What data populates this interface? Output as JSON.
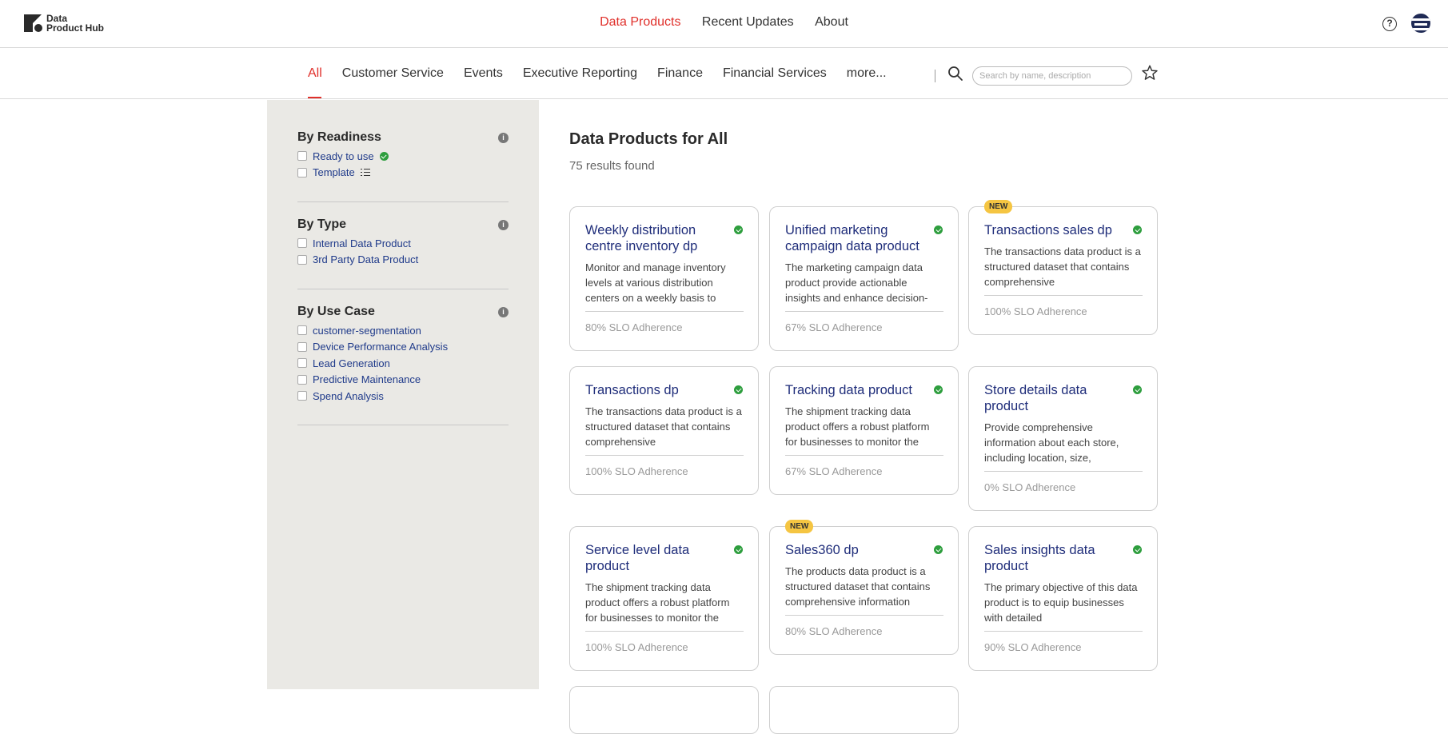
{
  "header": {
    "logo_line1": "Data",
    "logo_line2": "Product Hub",
    "nav": [
      "Data Products",
      "Recent Updates",
      "About"
    ],
    "help_glyph": "?"
  },
  "categories": {
    "tabs": [
      "All",
      "Customer Service",
      "Events",
      "Executive Reporting",
      "Finance",
      "Financial Services",
      "more..."
    ],
    "search_placeholder": "Search by name, description"
  },
  "sidebar": {
    "groups": [
      {
        "title": "By Readiness",
        "items": [
          "Ready to use",
          "Template"
        ]
      },
      {
        "title": "By Type",
        "items": [
          "Internal Data Product",
          "3rd Party Data Product"
        ]
      },
      {
        "title": "By Use Case",
        "items": [
          "customer-segmentation",
          "Device Performance Analysis",
          "Lead Generation",
          "Predictive Maintenance",
          "Spend Analysis"
        ]
      }
    ]
  },
  "main": {
    "title": "Data Products for All",
    "results": "75 results found",
    "new_label": "NEW",
    "cards": [
      {
        "title": "Weekly distribution centre inventory dp",
        "desc": "Monitor and manage inventory levels at various distribution centers on a weekly basis to",
        "slo": "80% SLO Adherence"
      },
      {
        "title": "Unified marketing campaign data product",
        "desc": "The marketing campaign data product provide actionable insights and enhance decision-",
        "slo": "67% SLO Adherence"
      },
      {
        "title": "Transactions sales dp",
        "desc": "The transactions data product is a structured dataset that contains comprehensive",
        "slo": "100% SLO Adherence"
      },
      {
        "title": "Transactions dp",
        "desc": "The transactions data product is a structured dataset that contains comprehensive",
        "slo": "100% SLO Adherence"
      },
      {
        "title": "Tracking data product",
        "desc": "The shipment tracking data product offers a robust platform for businesses to monitor the",
        "slo": "67% SLO Adherence"
      },
      {
        "title": "Store details data product",
        "desc": "Provide comprehensive information about each store, including location, size,",
        "slo": "0% SLO Adherence"
      },
      {
        "title": "Service level data product",
        "desc": "The shipment tracking data product offers a robust platform for businesses to monitor the",
        "slo": "100% SLO Adherence"
      },
      {
        "title": "Sales360 dp",
        "desc": "The products data product is a structured dataset that contains comprehensive information",
        "slo": "80% SLO Adherence"
      },
      {
        "title": "Sales insights data product",
        "desc": "The primary objective of this data product is to equip businesses with detailed",
        "slo": "90% SLO Adherence"
      }
    ]
  },
  "colors": {
    "accent": "#e0302b",
    "link": "#1f2d7a",
    "ready": "#2e9e3e",
    "new_badge": "#f5c542",
    "sidebar_bg": "#eae9e5"
  }
}
